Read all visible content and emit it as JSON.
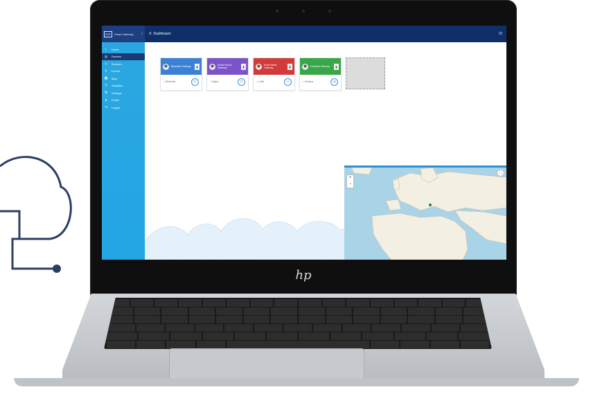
{
  "device": {
    "logo_text": "hp"
  },
  "app": {
    "brand": {
      "short": "STF",
      "name": "Smart Gateway"
    },
    "topbar": {
      "title": "Dashboard"
    },
    "sidebar": {
      "items": [
        {
          "label": "Home",
          "icon": "home-icon",
          "glyph": "⌂"
        },
        {
          "label": "Devices",
          "icon": "globe-icon",
          "glyph": "◎",
          "active": true
        },
        {
          "label": "Sensors",
          "icon": "user-icon",
          "glyph": "☺"
        },
        {
          "label": "Events",
          "icon": "bolt-icon",
          "glyph": "ϟ"
        },
        {
          "label": "Map",
          "icon": "map-icon",
          "glyph": "▦"
        },
        {
          "label": "Analytics",
          "icon": "funnel-icon",
          "glyph": "▽"
        },
        {
          "label": "Settings",
          "icon": "gear-icon",
          "glyph": "⚙"
        },
        {
          "label": "Profile",
          "icon": "person-icon",
          "glyph": "●"
        },
        {
          "label": "Logout",
          "icon": "logout-icon",
          "glyph": "⇥"
        }
      ]
    },
    "cards": [
      {
        "title": "Bluetooth Gateway",
        "status": "Bluetooth",
        "value": "BT",
        "color": "#3b82d6",
        "icon": "bluetooth-icon"
      },
      {
        "title": "Smart Sensor Gateway",
        "status": "Sigfox",
        "value": "SF",
        "color": "#7b54c9",
        "icon": "sensor-icon"
      },
      {
        "title": "Smart Meter Gateway",
        "status": "LoRa",
        "value": "LR",
        "color": "#d23b3b",
        "icon": "meter-icon"
      },
      {
        "title": "Industrial Gateway",
        "status": "Modbus",
        "value": "MB",
        "color": "#38a649",
        "icon": "factory-icon"
      }
    ],
    "map": {
      "zoom_in": "+",
      "zoom_out": "−",
      "fullscreen": "⛶"
    }
  }
}
